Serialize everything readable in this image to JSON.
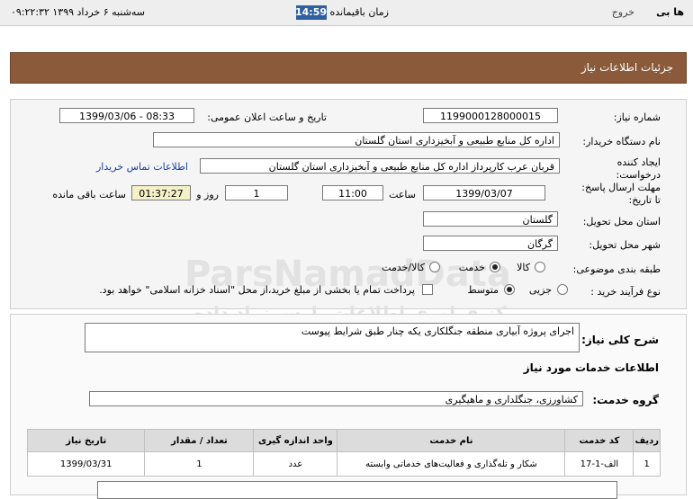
{
  "topbar": {
    "brand": "ها بی",
    "logout": "خروج",
    "time_remaining_label": "زمان باقیمانده :",
    "time_remaining_value": "14:59",
    "datetime": "سه‌شنبه ۶ خرداد ۱۳۹۹   ۰۹:۲۲:۳۲"
  },
  "header": {
    "title": "جزئیات اطلاعات نیاز"
  },
  "form": {
    "need_number_label": "شماره نیاز:",
    "need_number_value": "1199000128000015",
    "announce_label": "تاریخ و ساعت اعلان عمومی:",
    "announce_value": "1399/03/06 - 08:33",
    "buyer_label": "نام دستگاه خریدار:",
    "buyer_value": "اداره کل منابع طبیعی و آبخیزداری استان گلستان",
    "creator_label": "ایجاد کننده درخواست:",
    "creator_value": "قربان عرب کارپرداز اداره کل منابع طبیعی و آبخیزداری استان گلستان",
    "contact_link": "اطلاعات تماس خریدار",
    "deadline_label": "مهلت ارسال پاسخ: تا تاریخ:",
    "deadline_date": "1399/03/07",
    "hour_label": "ساعت",
    "deadline_time": "11:00",
    "days_value": "1",
    "days_label": "روز و",
    "remaining_value": "01:37:27",
    "remaining_label": "ساعت باقی مانده",
    "province_label": "استان محل تحویل:",
    "province_value": "گلستان",
    "city_label": "شهر محل تحویل:",
    "city_value": "گرگان",
    "category_label": "طبقه بندی موضوعی:",
    "category_options": [
      "کالا",
      "خدمت",
      "کالا/خدمت"
    ],
    "category_selected": "خدمت",
    "process_label": "نوع فرآیند خرید :",
    "process_options": [
      "جزیی",
      "متوسط"
    ],
    "process_selected": "متوسط",
    "treasury_text": "پرداخت تمام یا بخشی از مبلغ خرید،از محل \"اسناد خزانه اسلامی\" خواهد بود."
  },
  "details": {
    "summary_label": "شرح کلی نیاز:",
    "summary_value": "اجرای پروژه آبیاری منطقه جنگلکاری یکه چنار طبق شرایط پیوست",
    "services_title": "اطلاعات خدمات مورد نیاز",
    "service_group_label": "گروه خدمت:",
    "service_group_value": "کشاورزی، جنگلداری و ماهیگیری"
  },
  "table": {
    "headers": [
      "ردیف",
      "کد خدمت",
      "نام خدمت",
      "واحد اندازه گیری",
      "تعداد / مقدار",
      "تاریخ نیاز"
    ],
    "rows": [
      [
        "1",
        "الف-1-17",
        "شکار و تله‌گذاری و فعالیت‌های خدماتی وابسته",
        "عدد",
        "1",
        "1399/03/31"
      ]
    ]
  },
  "watermark": {
    "brand": "ParsNamadData",
    "line1": "مرکز فراوری اطلاعات پارس نماد داده",
    "line2": "پایگاه اطلاع رسانی مناقصه و مزایده",
    "phone": "۰۲۱-۸۸۳۴۹۶۷۰-۵"
  }
}
